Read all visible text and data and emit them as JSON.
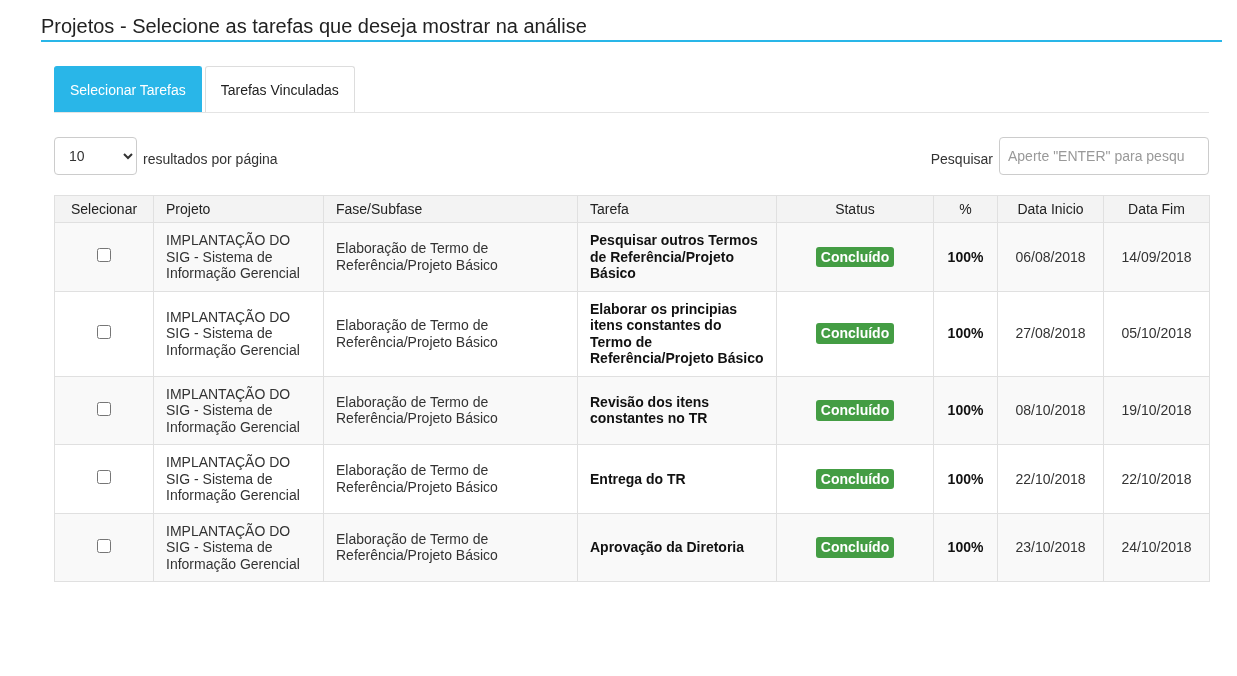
{
  "page_title": "Projetos - Selecione as tarefas que deseja mostrar na análise",
  "tabs": [
    {
      "label": "Selecionar Tarefas",
      "selected": true
    },
    {
      "label": "Tarefas Vinculadas",
      "selected": false
    }
  ],
  "page_size": {
    "value": "10",
    "label": "resultados por página"
  },
  "search": {
    "label": "Pesquisar",
    "placeholder": "Aperte \"ENTER\" para pesqu"
  },
  "table": {
    "columns": [
      "Selecionar",
      "Projeto",
      "Fase/Subfase",
      "Tarefa",
      "Status",
      "%",
      "Data Inicio",
      "Data Fim"
    ],
    "rows": [
      {
        "checked": false,
        "projeto": "IMPLANTAÇÃO DO SIG - Sistema de Informação Gerencial",
        "fase": "Elaboração de Termo de Referência/Projeto Básico",
        "tarefa": "Pesquisar outros Termos de Referência/Projeto Básico",
        "status": {
          "label": "Concluído",
          "kind": "success"
        },
        "percent": "100%",
        "inicio": "06/08/2018",
        "fim": "14/09/2018"
      },
      {
        "checked": false,
        "projeto": "IMPLANTAÇÃO DO SIG - Sistema de Informação Gerencial",
        "fase": "Elaboração de Termo de Referência/Projeto Básico",
        "tarefa": "Elaborar os principias itens constantes do Termo de Referência/Projeto Básico",
        "status": {
          "label": "Concluído",
          "kind": "success"
        },
        "percent": "100%",
        "inicio": "27/08/2018",
        "fim": "05/10/2018"
      },
      {
        "checked": false,
        "projeto": "IMPLANTAÇÃO DO SIG - Sistema de Informação Gerencial",
        "fase": "Elaboração de Termo de Referência/Projeto Básico",
        "tarefa": "Revisão dos itens constantes no TR",
        "status": {
          "label": "Concluído",
          "kind": "success"
        },
        "percent": "100%",
        "inicio": "08/10/2018",
        "fim": "19/10/2018"
      },
      {
        "checked": false,
        "projeto": "IMPLANTAÇÃO DO SIG - Sistema de Informação Gerencial",
        "fase": "Elaboração de Termo de Referência/Projeto Básico",
        "tarefa": "Entrega do TR",
        "status": {
          "label": "Concluído",
          "kind": "success"
        },
        "percent": "100%",
        "inicio": "22/10/2018",
        "fim": "22/10/2018"
      },
      {
        "checked": false,
        "projeto": "IMPLANTAÇÃO DO SIG - Sistema de Informação Gerencial",
        "fase": "Elaboração de Termo de Referência/Projeto Básico",
        "tarefa": "Aprovação da Diretoria",
        "status": {
          "label": "Concluído",
          "kind": "success"
        },
        "percent": "100%",
        "inicio": "23/10/2018",
        "fim": "24/10/2018"
      }
    ]
  }
}
